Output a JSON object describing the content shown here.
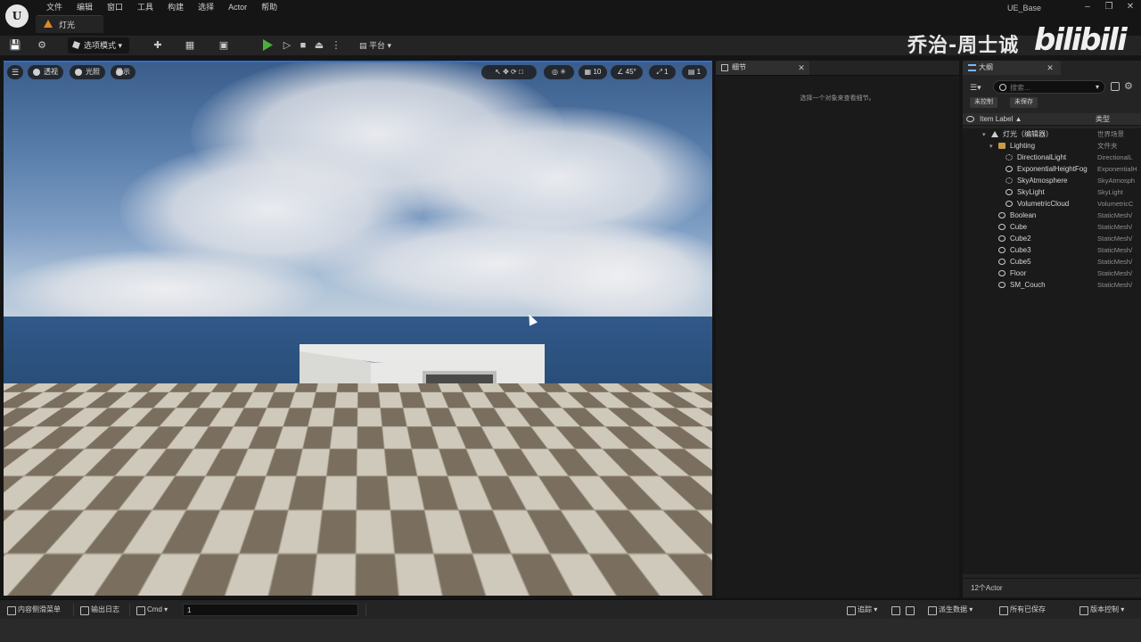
{
  "menubar": {
    "items": [
      "文件",
      "编辑",
      "窗口",
      "工具",
      "构建",
      "选择",
      "Actor",
      "帮助"
    ],
    "level_tab": "灯光",
    "project": "UE_Base"
  },
  "toolbar": {
    "mode_label": "选项模式",
    "platform_label": "平台"
  },
  "watermark": {
    "author": "乔治-周士诚",
    "logo": "bilibili"
  },
  "viewport": {
    "perspective_label": "透视",
    "lighting_label": "光照",
    "show_label": "显示",
    "grid_snap": "10",
    "rot_snap": "45°",
    "scale_snap": "1",
    "cam_speed": "1"
  },
  "details": {
    "tab_label": "细节",
    "empty_message": "选择一个对象来查看细节。"
  },
  "outliner": {
    "tab_label": "大纲",
    "search_placeholder": "搜索...",
    "chip_unsaved_ctrl": "未控制",
    "chip_unsaved": "未保存",
    "col_label": "Item Label ▲",
    "col_type": "类型",
    "rows": [
      {
        "label": "灯光（编辑器）",
        "type": "世界场景"
      },
      {
        "label": "Lighting",
        "type": "文件夹"
      },
      {
        "label": "DirectionalLight",
        "type": "DirectionalL"
      },
      {
        "label": "ExponentialHeightFog",
        "type": "ExponentialH"
      },
      {
        "label": "SkyAtmosphere",
        "type": "SkyAtmosph"
      },
      {
        "label": "SkyLight",
        "type": "SkyLight"
      },
      {
        "label": "VolumetricCloud",
        "type": "VolumetricC"
      },
      {
        "label": "Boolean",
        "type": "StaticMesh/"
      },
      {
        "label": "Cube",
        "type": "StaticMesh/"
      },
      {
        "label": "Cube2",
        "type": "StaticMesh/"
      },
      {
        "label": "Cube3",
        "type": "StaticMesh/"
      },
      {
        "label": "Cube5",
        "type": "StaticMesh/"
      },
      {
        "label": "Floor",
        "type": "StaticMesh/"
      },
      {
        "label": "SM_Couch",
        "type": "StaticMesh/"
      }
    ],
    "actor_count": "12个Actor"
  },
  "statusbar": {
    "content_drawer": "内容侧滑菜单",
    "output_log": "输出日志",
    "cmd_label": "Cmd",
    "cmd_value": "1",
    "trace": "追踪",
    "derived_data": "派生数据",
    "all_saved": "所有已保存",
    "source_control": "版本控制"
  },
  "colors": {
    "accent": "#2f6fcf",
    "play_green": "#4caf3c",
    "level_orange": "#d98a28"
  }
}
